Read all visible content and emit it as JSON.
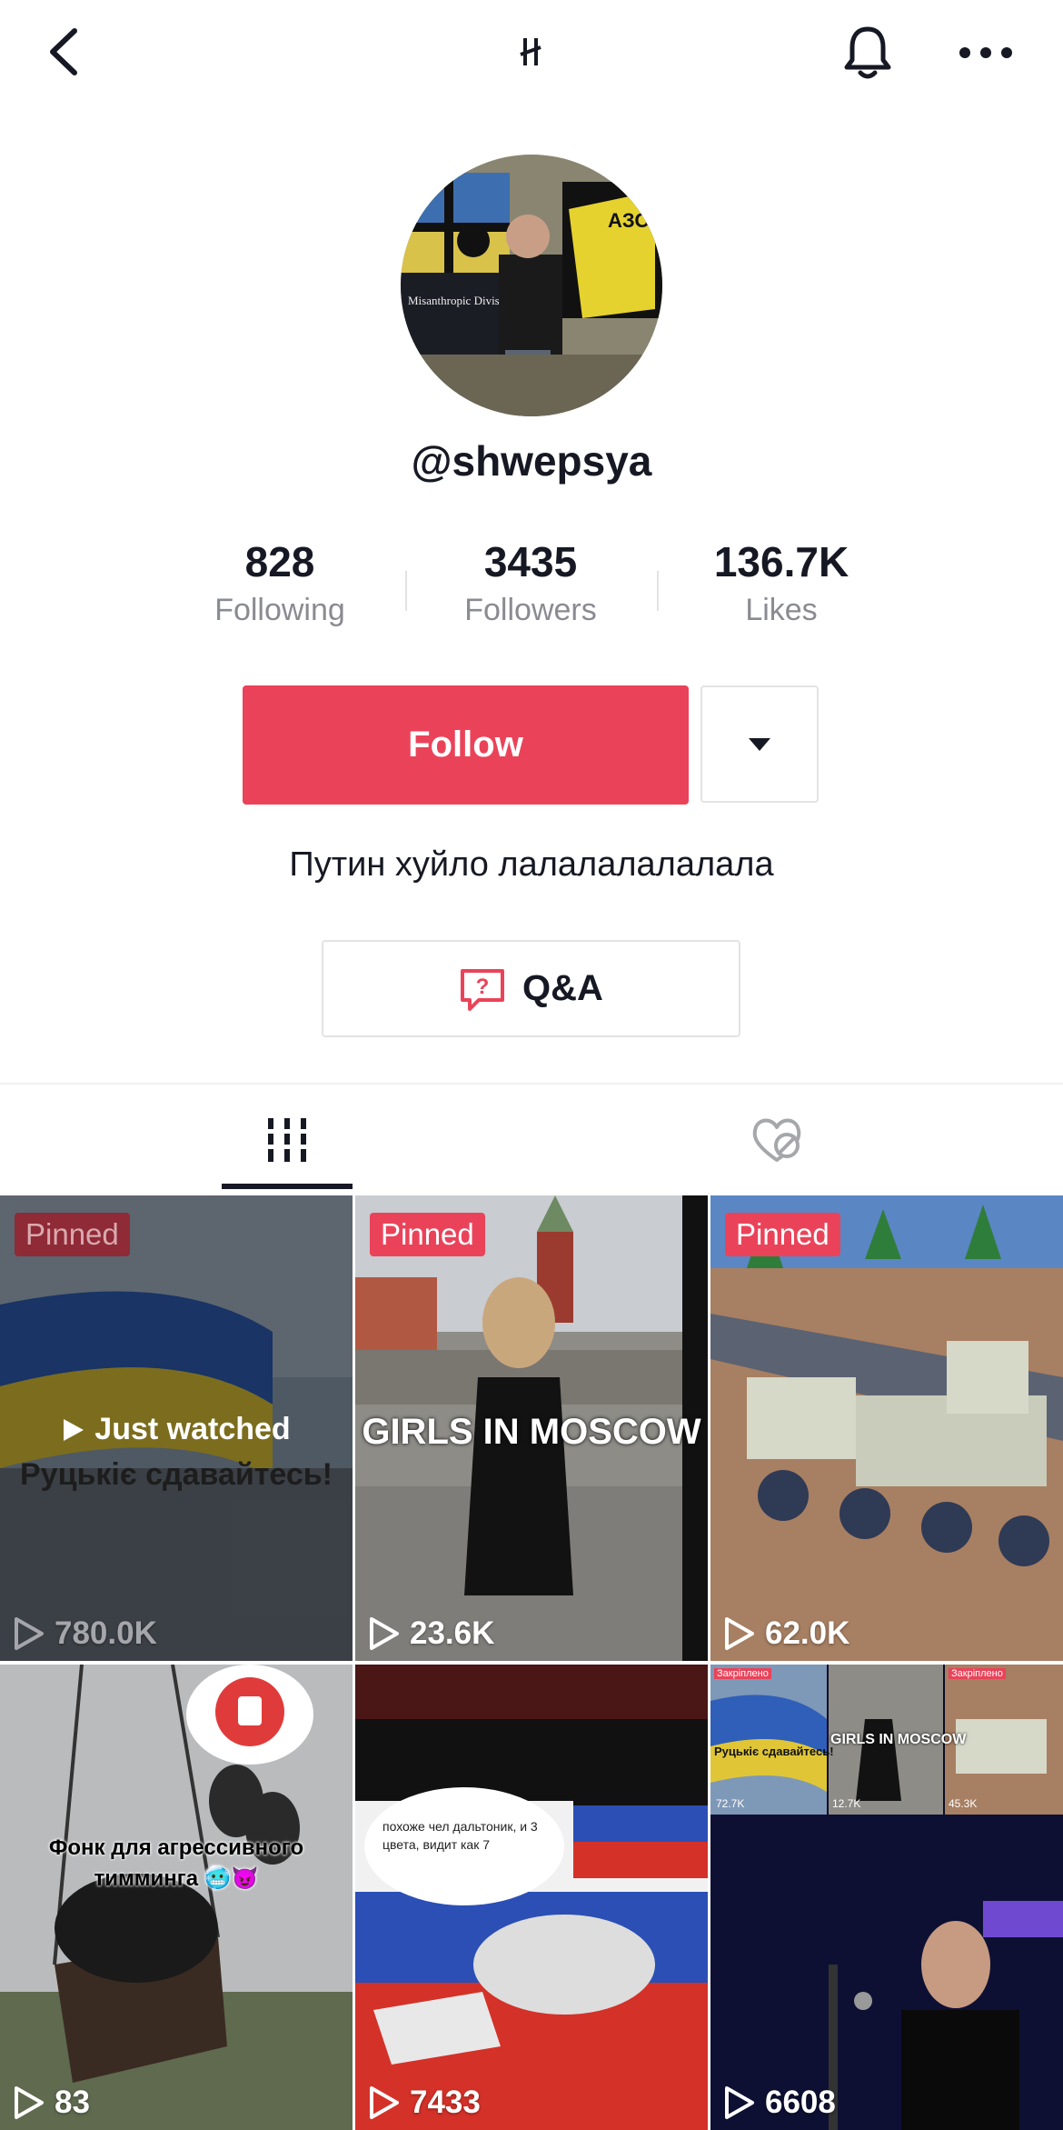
{
  "profile": {
    "username": "@shwepsya",
    "following_count": "828",
    "following_label": "Following",
    "followers_count": "3435",
    "followers_label": "Followers",
    "likes_count": "136.7K",
    "likes_label": "Likes",
    "follow_label": "Follow",
    "bio": "Путин хуйло лалалалалалала",
    "qa_label": "Q&A"
  },
  "icons": {
    "back": "chevron-left-icon",
    "center": "brand-glyph-icon",
    "bell": "bell-icon",
    "more": "more-icon",
    "dropdown": "triangle-down-icon",
    "qa": "question-bubble-icon",
    "videos_tab": "grid-icon",
    "liked_tab": "liked-hidden-icon"
  },
  "avatar_text": {
    "banner": "Misanthropic Division",
    "patch": "АЗОВ"
  },
  "videos": [
    {
      "pinned": "Pinned",
      "views": "780.0K",
      "status": "Just watched",
      "caption": "Руцькіє сдавайтесь!"
    },
    {
      "pinned": "Pinned",
      "views": "23.6K",
      "caption": "GIRLS IN MOSCOW"
    },
    {
      "pinned": "Pinned",
      "views": "62.0K"
    },
    {
      "views": "83",
      "caption": "Фонк для агрессивного тимминга 🥶😈"
    },
    {
      "views": "7433",
      "caption": "похоже чел дальтоник, и 3 цвета, видит как 7"
    },
    {
      "views": "6608",
      "mini_views": [
        "72.7K",
        "12.7K",
        "45.3K"
      ],
      "mini_pinned": "Закріплено",
      "mini_caption_1": "Руцькіє сдавайтесь!",
      "mini_caption_2": "GIRLS IN MOSCOW"
    }
  ],
  "colors": {
    "accent": "#ea4359",
    "text": "#161823",
    "muted": "#8a8b91",
    "border": "#e3e3e4"
  }
}
